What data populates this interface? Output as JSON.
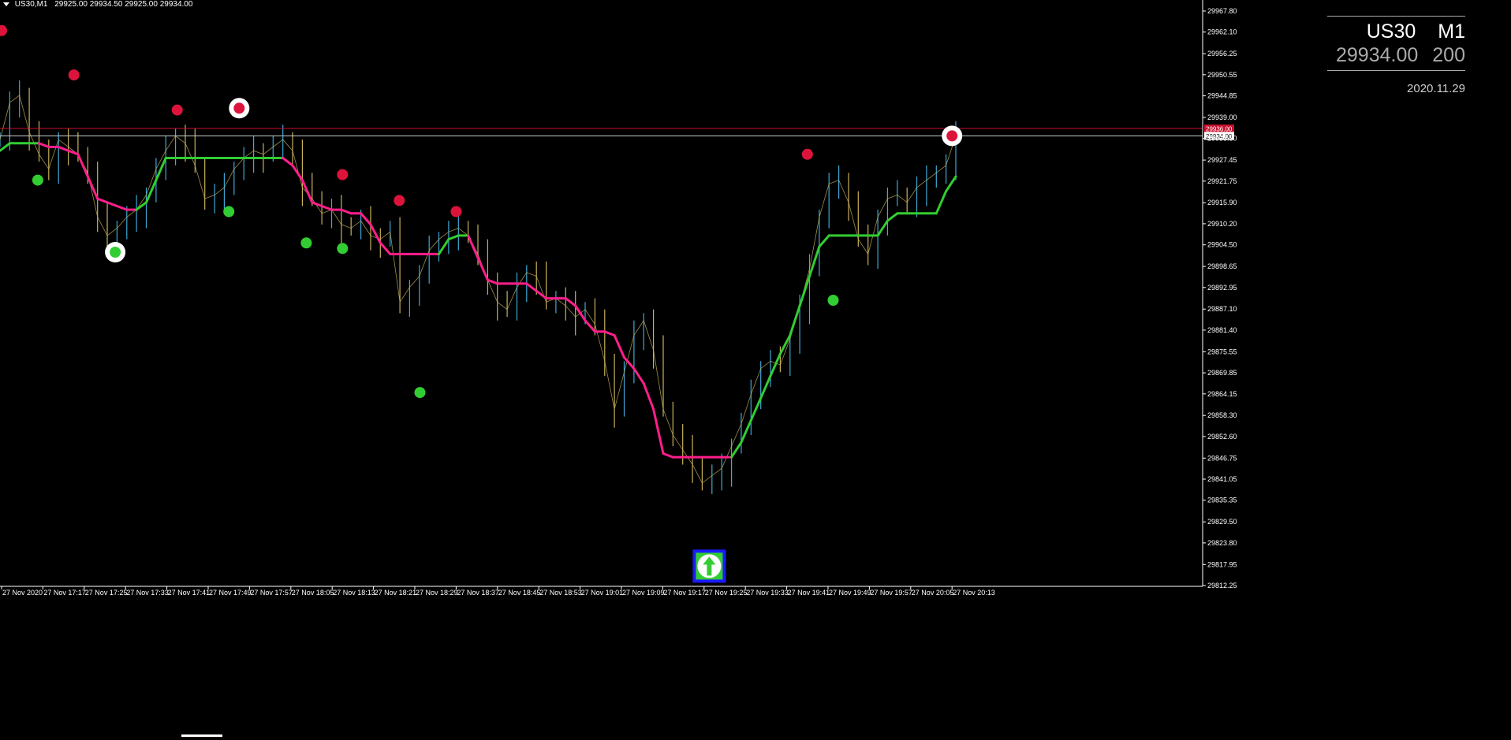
{
  "header": {
    "symbol_timeframe": "US30,M1",
    "ohlc": "29925.00 29934.50 29925.00 29934.00"
  },
  "info_panel": {
    "symbol": "US30",
    "timeframe": "M1",
    "price": "29934.00",
    "spread": "200",
    "date": "2020.11.29"
  },
  "chart_data": {
    "type": "line",
    "title": "",
    "y_ticks": [
      "29967.80",
      "29962.10",
      "29956.25",
      "29950.55",
      "29944.85",
      "29939.00",
      "29933.30",
      "29927.45",
      "29921.75",
      "29915.90",
      "29910.20",
      "29904.50",
      "29898.65",
      "29892.95",
      "29887.10",
      "29881.40",
      "29875.55",
      "29869.85",
      "29864.15",
      "29858.30",
      "29852.60",
      "29846.75",
      "29841.05",
      "29835.35",
      "29829.50",
      "29823.80",
      "29817.95",
      "29812.25"
    ],
    "x_ticks": [
      "27 Nov 2020",
      "27 Nov 17:17",
      "27 Nov 17:25",
      "27 Nov 17:33",
      "27 Nov 17:41",
      "27 Nov 17:49",
      "27 Nov 17:57",
      "27 Nov 18:05",
      "27 Nov 18:13",
      "27 Nov 18:21",
      "27 Nov 18:29",
      "27 Nov 18:37",
      "27 Nov 18:45",
      "27 Nov 18:53",
      "27 Nov 19:01",
      "27 Nov 19:09",
      "27 Nov 19:17",
      "27 Nov 19:25",
      "27 Nov 19:33",
      "27 Nov 19:41",
      "27 Nov 19:49",
      "27 Nov 19:57",
      "27 Nov 20:05",
      "27 Nov 20:13"
    ],
    "price_lines": [
      {
        "label": "29936.00",
        "value": 29936.0,
        "color": "#c8102e"
      },
      {
        "label": "29934.00",
        "value": 29934.0,
        "color": "#cfcfcf"
      }
    ],
    "price_series": [
      29933,
      29943,
      29945,
      29935,
      29929,
      29925,
      29933,
      29931,
      29929,
      29924,
      29912,
      29907,
      29909,
      29912,
      29914,
      29918,
      29925,
      29930,
      29934,
      29932,
      29926,
      29917,
      29918,
      29920,
      29925,
      29928,
      29930,
      29929,
      29931,
      29933,
      29930,
      29920,
      29917,
      29913,
      29914,
      29910,
      29909,
      29911,
      29907,
      29906,
      29908,
      29889,
      29893,
      29896,
      29903,
      29906,
      29908,
      29909,
      29907,
      29902,
      29895,
      29889,
      29887,
      29893,
      29897,
      29896,
      29889,
      29890,
      29888,
      29885,
      29887,
      29883,
      29873,
      29860,
      29870,
      29880,
      29884,
      29876,
      29860,
      29853,
      29849,
      29845,
      29840,
      29842,
      29844,
      29850,
      29856,
      29864,
      29871,
      29873,
      29872,
      29879,
      29888,
      29898,
      29912,
      29921,
      29922,
      29916,
      29906,
      29902,
      29912,
      29917,
      29918,
      29916,
      29920,
      29922,
      29924,
      29926,
      29934
    ],
    "cloud_series": [
      29930,
      29932,
      29932,
      29932,
      29932,
      29931,
      29931,
      29930,
      29929,
      29923,
      29917,
      29916,
      29915,
      29914,
      29914,
      29916,
      29922,
      29928,
      29928,
      29928,
      29928,
      29928,
      29928,
      29928,
      29928,
      29928,
      29928,
      29928,
      29928,
      29928,
      29926,
      29922,
      29916,
      29915,
      29914,
      29914,
      29913,
      29913,
      29910,
      29905,
      29902,
      29902,
      29902,
      29902,
      29902,
      29902,
      29906,
      29907,
      29907,
      29901,
      29895,
      29894,
      29894,
      29894,
      29894,
      29892,
      29890,
      29890,
      29890,
      29888,
      29884,
      29881,
      29881,
      29880,
      29874,
      29871,
      29867,
      29860,
      29848,
      29847,
      29847,
      29847,
      29847,
      29847,
      29847,
      29847,
      29851,
      29857,
      29863,
      29869,
      29875,
      29880,
      29888,
      29896,
      29904,
      29907,
      29907,
      29907,
      29907,
      29907,
      29907,
      29911,
      29913,
      29913,
      29913,
      29913,
      29913,
      29919,
      29923
    ],
    "sell_markers": [
      {
        "time": "27 Nov 2020",
        "price": 29962.5
      },
      {
        "time": "27 Nov 17:23",
        "price": 29950.5
      },
      {
        "time": "27 Nov 17:43",
        "price": 29941.0
      },
      {
        "time": "27 Nov 17:55",
        "price": 29941.5,
        "highlighted": true
      },
      {
        "time": "27 Nov 18:15",
        "price": 29923.5
      },
      {
        "time": "27 Nov 18:26",
        "price": 29916.5
      },
      {
        "time": "27 Nov 18:37",
        "price": 29913.5
      },
      {
        "time": "27 Nov 19:45",
        "price": 29929.0
      },
      {
        "time": "27 Nov 20:13",
        "price": 29934.0,
        "highlighted": true
      }
    ],
    "buy_markers": [
      {
        "time": "27 Nov 17:16",
        "price": 29922.0
      },
      {
        "time": "27 Nov 17:31",
        "price": 29902.5,
        "highlighted": true
      },
      {
        "time": "27 Nov 17:53",
        "price": 29913.5
      },
      {
        "time": "27 Nov 18:08",
        "price": 29905.0
      },
      {
        "time": "27 Nov 18:15",
        "price": 29903.5
      },
      {
        "time": "27 Nov 18:30",
        "price": 29864.5
      },
      {
        "time": "27 Nov 19:50",
        "price": 29889.5
      }
    ],
    "arrow_signal": {
      "time": "27 Nov 19:26",
      "price": 29817.5,
      "direction": "up"
    },
    "colors": {
      "up_bar": "#3fa9d6",
      "down_bar": "#c8b25a",
      "sell": "#dc143c",
      "buy": "#32cd32",
      "cloud_up": "#32cd32",
      "cloud_down": "#ff1e8c",
      "signal_box": "#1a1aff"
    }
  }
}
